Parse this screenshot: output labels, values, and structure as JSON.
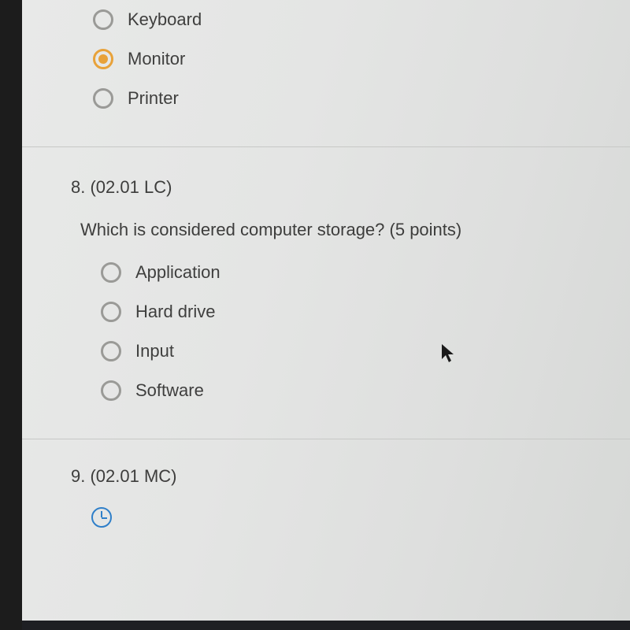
{
  "q7_tail": {
    "options": [
      {
        "label": "Keyboard",
        "selected": false
      },
      {
        "label": "Monitor",
        "selected": true
      },
      {
        "label": "Printer",
        "selected": false
      }
    ]
  },
  "q8": {
    "header": "8.  (02.01 LC)",
    "text": "Which is considered computer storage? (5 points)",
    "options": [
      {
        "label": "Application",
        "selected": false
      },
      {
        "label": "Hard drive",
        "selected": false
      },
      {
        "label": "Input",
        "selected": false
      },
      {
        "label": "Software",
        "selected": false
      }
    ]
  },
  "q9": {
    "header": "9.  (02.01 MC)"
  }
}
